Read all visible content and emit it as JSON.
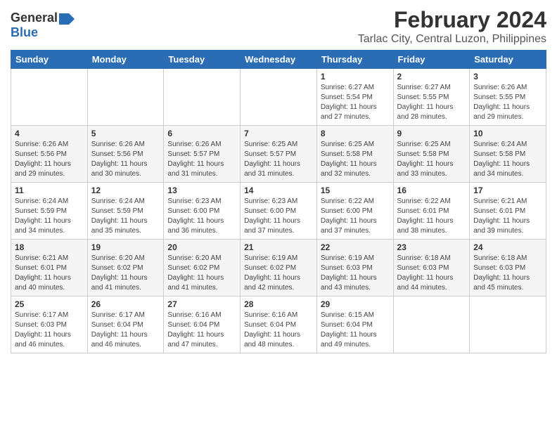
{
  "header": {
    "logo_general": "General",
    "logo_blue": "Blue",
    "main_title": "February 2024",
    "subtitle": "Tarlac City, Central Luzon, Philippines"
  },
  "weekdays": [
    "Sunday",
    "Monday",
    "Tuesday",
    "Wednesday",
    "Thursday",
    "Friday",
    "Saturday"
  ],
  "weeks": [
    [
      {
        "day": "",
        "sunrise": "",
        "sunset": "",
        "daylight": ""
      },
      {
        "day": "",
        "sunrise": "",
        "sunset": "",
        "daylight": ""
      },
      {
        "day": "",
        "sunrise": "",
        "sunset": "",
        "daylight": ""
      },
      {
        "day": "",
        "sunrise": "",
        "sunset": "",
        "daylight": ""
      },
      {
        "day": "1",
        "sunrise": "Sunrise: 6:27 AM",
        "sunset": "Sunset: 5:54 PM",
        "daylight": "Daylight: 11 hours and 27 minutes."
      },
      {
        "day": "2",
        "sunrise": "Sunrise: 6:27 AM",
        "sunset": "Sunset: 5:55 PM",
        "daylight": "Daylight: 11 hours and 28 minutes."
      },
      {
        "day": "3",
        "sunrise": "Sunrise: 6:26 AM",
        "sunset": "Sunset: 5:55 PM",
        "daylight": "Daylight: 11 hours and 29 minutes."
      }
    ],
    [
      {
        "day": "4",
        "sunrise": "Sunrise: 6:26 AM",
        "sunset": "Sunset: 5:56 PM",
        "daylight": "Daylight: 11 hours and 29 minutes."
      },
      {
        "day": "5",
        "sunrise": "Sunrise: 6:26 AM",
        "sunset": "Sunset: 5:56 PM",
        "daylight": "Daylight: 11 hours and 30 minutes."
      },
      {
        "day": "6",
        "sunrise": "Sunrise: 6:26 AM",
        "sunset": "Sunset: 5:57 PM",
        "daylight": "Daylight: 11 hours and 31 minutes."
      },
      {
        "day": "7",
        "sunrise": "Sunrise: 6:25 AM",
        "sunset": "Sunset: 5:57 PM",
        "daylight": "Daylight: 11 hours and 31 minutes."
      },
      {
        "day": "8",
        "sunrise": "Sunrise: 6:25 AM",
        "sunset": "Sunset: 5:58 PM",
        "daylight": "Daylight: 11 hours and 32 minutes."
      },
      {
        "day": "9",
        "sunrise": "Sunrise: 6:25 AM",
        "sunset": "Sunset: 5:58 PM",
        "daylight": "Daylight: 11 hours and 33 minutes."
      },
      {
        "day": "10",
        "sunrise": "Sunrise: 6:24 AM",
        "sunset": "Sunset: 5:58 PM",
        "daylight": "Daylight: 11 hours and 34 minutes."
      }
    ],
    [
      {
        "day": "11",
        "sunrise": "Sunrise: 6:24 AM",
        "sunset": "Sunset: 5:59 PM",
        "daylight": "Daylight: 11 hours and 34 minutes."
      },
      {
        "day": "12",
        "sunrise": "Sunrise: 6:24 AM",
        "sunset": "Sunset: 5:59 PM",
        "daylight": "Daylight: 11 hours and 35 minutes."
      },
      {
        "day": "13",
        "sunrise": "Sunrise: 6:23 AM",
        "sunset": "Sunset: 6:00 PM",
        "daylight": "Daylight: 11 hours and 36 minutes."
      },
      {
        "day": "14",
        "sunrise": "Sunrise: 6:23 AM",
        "sunset": "Sunset: 6:00 PM",
        "daylight": "Daylight: 11 hours and 37 minutes."
      },
      {
        "day": "15",
        "sunrise": "Sunrise: 6:22 AM",
        "sunset": "Sunset: 6:00 PM",
        "daylight": "Daylight: 11 hours and 37 minutes."
      },
      {
        "day": "16",
        "sunrise": "Sunrise: 6:22 AM",
        "sunset": "Sunset: 6:01 PM",
        "daylight": "Daylight: 11 hours and 38 minutes."
      },
      {
        "day": "17",
        "sunrise": "Sunrise: 6:21 AM",
        "sunset": "Sunset: 6:01 PM",
        "daylight": "Daylight: 11 hours and 39 minutes."
      }
    ],
    [
      {
        "day": "18",
        "sunrise": "Sunrise: 6:21 AM",
        "sunset": "Sunset: 6:01 PM",
        "daylight": "Daylight: 11 hours and 40 minutes."
      },
      {
        "day": "19",
        "sunrise": "Sunrise: 6:20 AM",
        "sunset": "Sunset: 6:02 PM",
        "daylight": "Daylight: 11 hours and 41 minutes."
      },
      {
        "day": "20",
        "sunrise": "Sunrise: 6:20 AM",
        "sunset": "Sunset: 6:02 PM",
        "daylight": "Daylight: 11 hours and 41 minutes."
      },
      {
        "day": "21",
        "sunrise": "Sunrise: 6:19 AM",
        "sunset": "Sunset: 6:02 PM",
        "daylight": "Daylight: 11 hours and 42 minutes."
      },
      {
        "day": "22",
        "sunrise": "Sunrise: 6:19 AM",
        "sunset": "Sunset: 6:03 PM",
        "daylight": "Daylight: 11 hours and 43 minutes."
      },
      {
        "day": "23",
        "sunrise": "Sunrise: 6:18 AM",
        "sunset": "Sunset: 6:03 PM",
        "daylight": "Daylight: 11 hours and 44 minutes."
      },
      {
        "day": "24",
        "sunrise": "Sunrise: 6:18 AM",
        "sunset": "Sunset: 6:03 PM",
        "daylight": "Daylight: 11 hours and 45 minutes."
      }
    ],
    [
      {
        "day": "25",
        "sunrise": "Sunrise: 6:17 AM",
        "sunset": "Sunset: 6:03 PM",
        "daylight": "Daylight: 11 hours and 46 minutes."
      },
      {
        "day": "26",
        "sunrise": "Sunrise: 6:17 AM",
        "sunset": "Sunset: 6:04 PM",
        "daylight": "Daylight: 11 hours and 46 minutes."
      },
      {
        "day": "27",
        "sunrise": "Sunrise: 6:16 AM",
        "sunset": "Sunset: 6:04 PM",
        "daylight": "Daylight: 11 hours and 47 minutes."
      },
      {
        "day": "28",
        "sunrise": "Sunrise: 6:16 AM",
        "sunset": "Sunset: 6:04 PM",
        "daylight": "Daylight: 11 hours and 48 minutes."
      },
      {
        "day": "29",
        "sunrise": "Sunrise: 6:15 AM",
        "sunset": "Sunset: 6:04 PM",
        "daylight": "Daylight: 11 hours and 49 minutes."
      },
      {
        "day": "",
        "sunrise": "",
        "sunset": "",
        "daylight": ""
      },
      {
        "day": "",
        "sunrise": "",
        "sunset": "",
        "daylight": ""
      }
    ]
  ]
}
